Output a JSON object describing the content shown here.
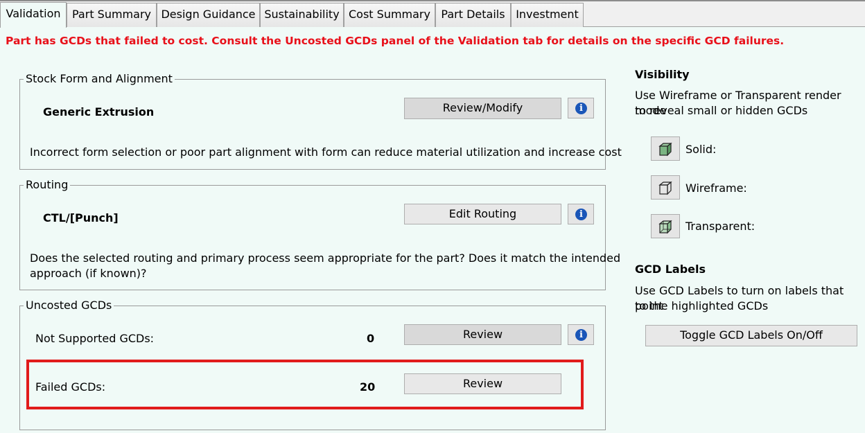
{
  "tabs": [
    "Validation",
    "Part Summary",
    "Design Guidance",
    "Sustainability",
    "Cost Summary",
    "Part Details",
    "Investment"
  ],
  "warning": "Part has GCDs that failed to cost. Consult the Uncosted GCDs panel of the Validation tab for details on the specific GCD failures.",
  "stock_form": {
    "legend": "Stock Form and Alignment",
    "value": "Generic Extrusion",
    "button": "Review/Modify",
    "description": "Incorrect form selection or poor part alignment with form can reduce material utilization and increase cost"
  },
  "routing": {
    "legend": "Routing",
    "value": "CTL/[Punch]",
    "button": "Edit Routing",
    "description_line1": "Does the selected routing and primary process seem appropriate for the part? Does it match the intended",
    "description_line2": "approach (if known)?"
  },
  "uncosted": {
    "legend": "Uncosted GCDs",
    "not_supported_label": "Not Supported GCDs:",
    "not_supported_count": "0",
    "failed_label": "Failed GCDs:",
    "failed_count": "20",
    "review_label": "Review"
  },
  "visibility": {
    "title": "Visibility",
    "line1": "Use Wireframe or Transparent render mode",
    "line2": "to reveal small or hidden GCDs",
    "modes": [
      "Solid:",
      "Wireframe:",
      "Transparent:"
    ]
  },
  "gcd_labels": {
    "title": "GCD Labels",
    "line1": "Use GCD Labels to turn on labels that point",
    "line2": "to the highlighted GCDs",
    "button": "Toggle GCD Labels On/Off"
  },
  "icons": {
    "info": "info-icon",
    "solid": "solid-cube-icon",
    "wireframe": "wireframe-cube-icon",
    "transparent": "transparent-cube-icon"
  },
  "colors": {
    "warning": "#e8101a",
    "highlight": "#e11b1b",
    "background": "#f0faf7"
  }
}
